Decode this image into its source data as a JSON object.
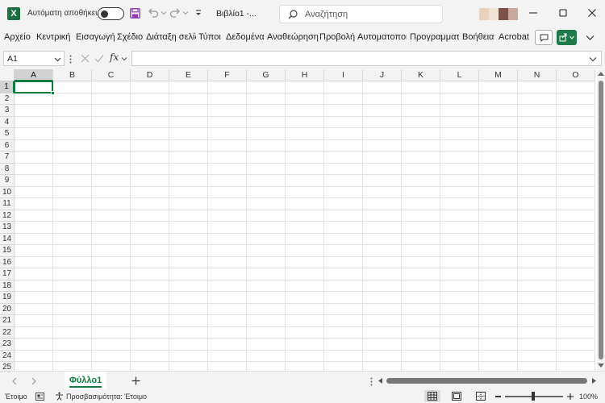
{
  "titlebar": {
    "autosave_label": "Αυτόματη αποθήκευση",
    "doc_title": "Βιβλίο1  -...",
    "search_placeholder": "Αναζήτηση",
    "app_icon_letter": "X",
    "accent": "#107c41"
  },
  "ribbon": {
    "tabs": [
      "Αρχείο",
      "Κεντρική",
      "Εισαγωγή",
      "Σχέδιο",
      "Διάταξη σελίδ",
      "Τύποι",
      "Δεδομένα",
      "Αναθεώρηση",
      "Προβολή",
      "Αυτοματοποι",
      "Προγραμματ",
      "Βοήθεια",
      "Acrobat"
    ]
  },
  "formula_bar": {
    "name_box": "A1",
    "fx": "fx",
    "formula": ""
  },
  "grid": {
    "columns": [
      "A",
      "B",
      "C",
      "D",
      "E",
      "F",
      "G",
      "H",
      "I",
      "J",
      "K",
      "L",
      "M",
      "N",
      "O"
    ],
    "rows": [
      "1",
      "2",
      "3",
      "4",
      "5",
      "6",
      "7",
      "8",
      "9",
      "10",
      "11",
      "12",
      "13",
      "14",
      "15",
      "16",
      "17",
      "18",
      "19",
      "20",
      "21",
      "22",
      "23",
      "24",
      "25"
    ],
    "active_cell": "A1"
  },
  "sheets": {
    "tabs": [
      "Φύλλο1"
    ],
    "active": "Φύλλο1"
  },
  "statusbar": {
    "ready": "Έτοιμο",
    "accessibility": "Προσβασιμότητα: Έτοιμο",
    "zoom": "100%"
  }
}
